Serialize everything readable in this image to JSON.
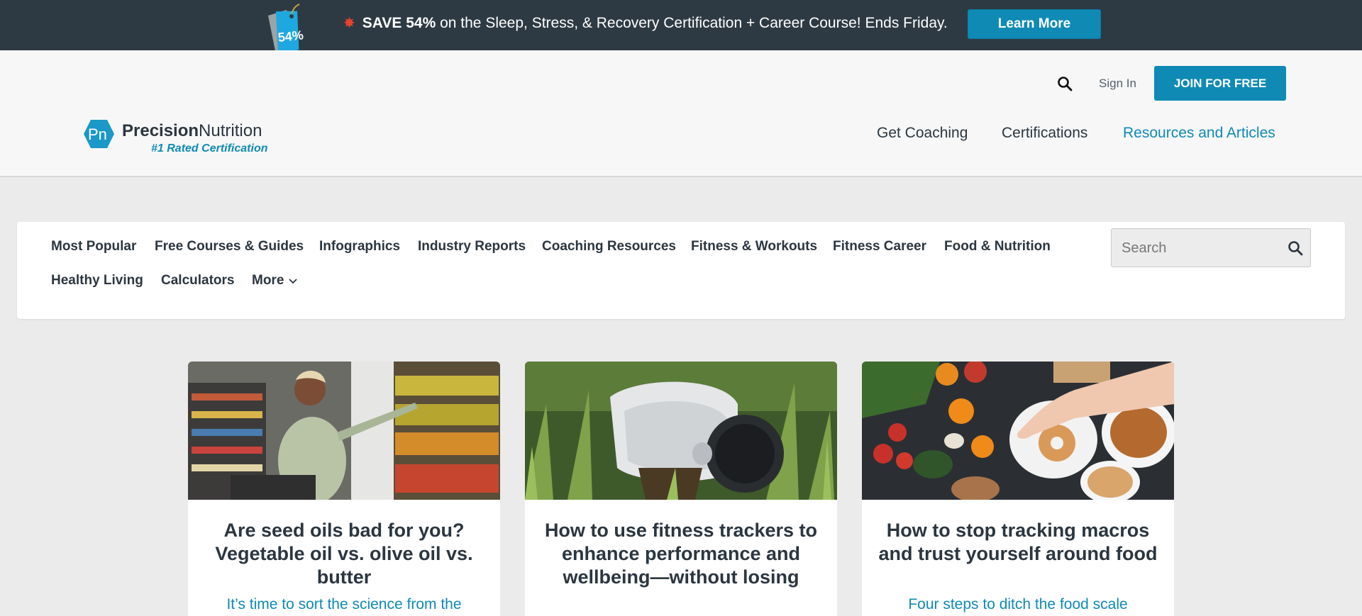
{
  "promo": {
    "tag": "54%",
    "bold": "SAVE 54%",
    "text": " on the Sleep, Stress, & Recovery Certification + Career Course! Ends Friday.",
    "cta": "Learn More"
  },
  "header": {
    "signin": "Sign In",
    "join": "JOIN FOR FREE",
    "logo_mark": "Pn",
    "logo_bold": "Precision",
    "logo_rest": "Nutrition",
    "logo_sub": "#1 Rated Certification",
    "nav": [
      "Get Coaching",
      "Certifications",
      "Resources and Articles"
    ]
  },
  "categories": [
    "Most Popular",
    "Free Courses & Guides",
    "Infographics",
    "Industry Reports",
    "Coaching Resources",
    "Fitness & Workouts",
    "Fitness Career",
    "Food & Nutrition",
    "Healthy Living",
    "Calculators",
    "More"
  ],
  "search": {
    "placeholder": "Search"
  },
  "articles": [
    {
      "title": "Are seed oils bad for you? Vegetable oil vs. olive oil vs. butter",
      "subtitle": "It’s time to sort the science from the"
    },
    {
      "title": "How to use fitness trackers to enhance performance and wellbeing—without losing",
      "subtitle": ""
    },
    {
      "title": "How to stop tracking macros and trust yourself around food",
      "subtitle": "Four steps to ditch the food scale"
    }
  ],
  "colors": {
    "brand": "#0f8ab5",
    "banner": "#2e3a43",
    "text": "#2b3640"
  }
}
